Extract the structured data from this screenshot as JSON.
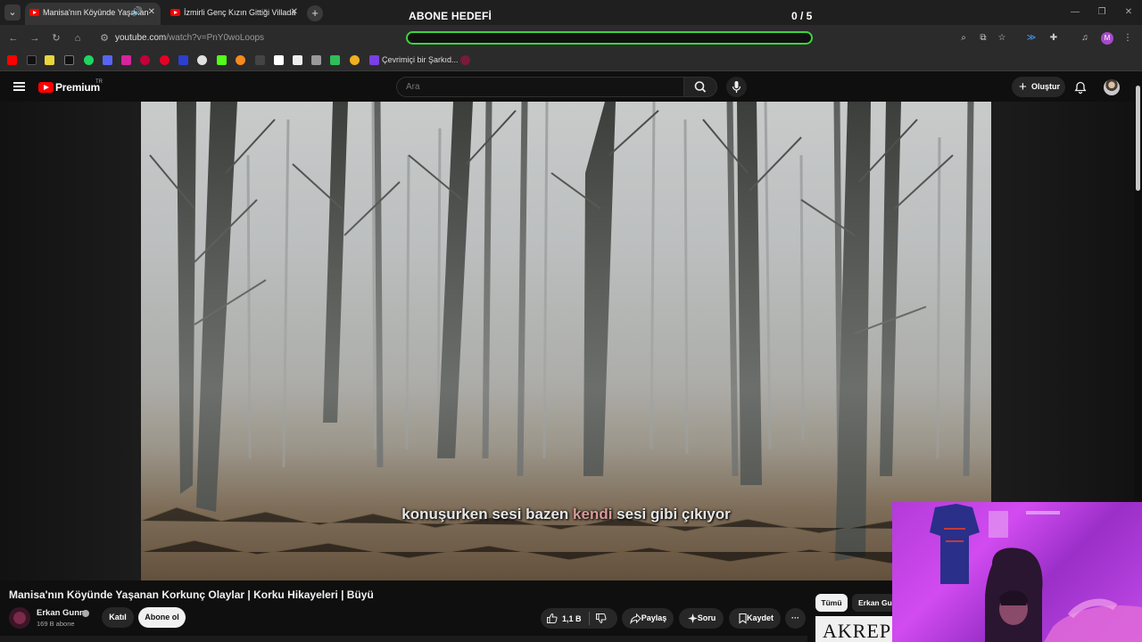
{
  "browser": {
    "tabs": [
      {
        "title": "Manisa'nın Köyünde Yaşanan",
        "active": true,
        "audio": true
      },
      {
        "title": "İzmirli Genç Kızın Gittiği Villada",
        "active": false
      }
    ],
    "url_main": "youtube.com",
    "url_path": "/watch?v=PnY0woLoops",
    "bookmark_label": "Çevrimiçi bir Şarkıd...",
    "profile_initial": "M"
  },
  "overlay": {
    "goal_title": "ABONE HEDEFİ",
    "goal_count": "0 / 5",
    "goal_progress": 0,
    "accent": "#3dd43d"
  },
  "youtube": {
    "logo_text": "Premium",
    "logo_region": "TR",
    "search_placeholder": "Ara",
    "create_label": "Oluştur"
  },
  "video": {
    "subtitle_before": "konuşurken sesi bazen ",
    "subtitle_highlight": "kendi",
    "subtitle_after": " sesi gibi çıkıyor",
    "title": "Manisa'nın Köyünde Yaşanan Korkunç Olaylar | Korku Hikayeleri | Büyü"
  },
  "channel": {
    "name": "Erkan Gunn",
    "subscribers": "169 B abone",
    "join_label": "Katıl",
    "subscribe_label": "Abone ol"
  },
  "actions": {
    "like_count": "1,1 B",
    "share_label": "Paylaş",
    "ask_label": "Soru",
    "save_label": "Kaydet"
  },
  "sidebar": {
    "chips": [
      "Tümü",
      "Erkan Gunn"
    ],
    "thumbnail_text": "AKREP"
  }
}
